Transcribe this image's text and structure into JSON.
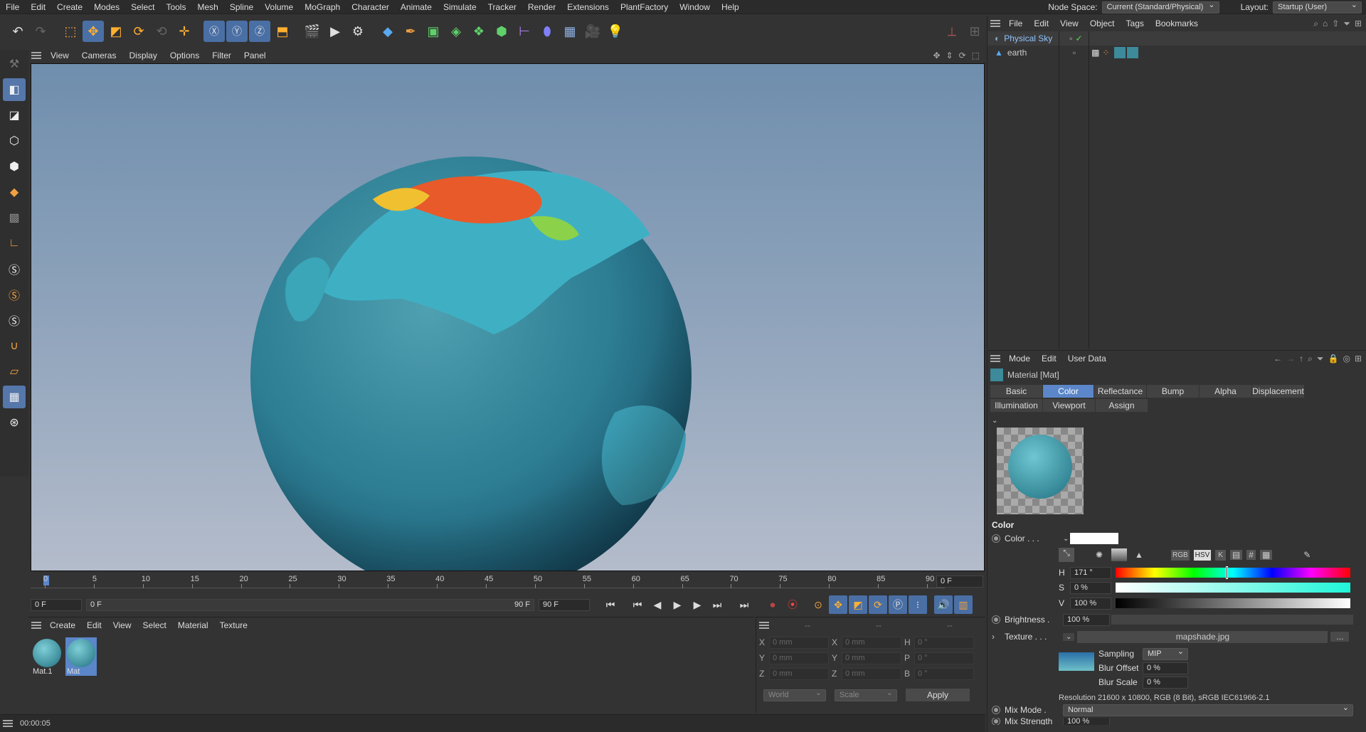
{
  "menubar": {
    "items": [
      "File",
      "Edit",
      "Create",
      "Modes",
      "Select",
      "Tools",
      "Mesh",
      "Spline",
      "Volume",
      "MoGraph",
      "Character",
      "Animate",
      "Simulate",
      "Tracker",
      "Render",
      "Extensions",
      "PlantFactory",
      "Window",
      "Help"
    ],
    "node_space_label": "Node Space:",
    "node_space_value": "Current (Standard/Physical)",
    "layout_label": "Layout:",
    "layout_value": "Startup (User)"
  },
  "viewport": {
    "menu": [
      "View",
      "Cameras",
      "Display",
      "Options",
      "Filter",
      "Panel"
    ]
  },
  "timeline": {
    "ticks": [
      "0",
      "5",
      "10",
      "15",
      "20",
      "25",
      "30",
      "35",
      "40",
      "45",
      "50",
      "55",
      "60",
      "65",
      "70",
      "75",
      "80",
      "85",
      "90"
    ],
    "current_frame": "0 F",
    "start_field": "0 F",
    "range_start": "0 F",
    "range_end": "90 F",
    "end_field": "90 F"
  },
  "material_manager": {
    "menu": [
      "Create",
      "Edit",
      "View",
      "Select",
      "Material",
      "Texture"
    ],
    "materials": [
      {
        "name": "Mat.1",
        "selected": false
      },
      {
        "name": "Mat",
        "selected": true
      }
    ]
  },
  "coordinates": {
    "header": [
      "--",
      "--",
      "--"
    ],
    "rows": [
      {
        "a": "X",
        "av": "0 mm",
        "b": "X",
        "bv": "0 mm",
        "c": "H",
        "cv": "0 °"
      },
      {
        "a": "Y",
        "av": "0 mm",
        "b": "Y",
        "bv": "0 mm",
        "c": "P",
        "cv": "0 °"
      },
      {
        "a": "Z",
        "av": "0 mm",
        "b": "Z",
        "bv": "0 mm",
        "c": "B",
        "cv": "0 °"
      }
    ],
    "space_select": "World",
    "mode_select": "Scale",
    "apply_label": "Apply"
  },
  "status": {
    "time": "00:00:05"
  },
  "object_manager": {
    "menu": [
      "File",
      "Edit",
      "View",
      "Object",
      "Tags",
      "Bookmarks"
    ],
    "objects": [
      {
        "name": "Physical Sky"
      },
      {
        "name": "earth"
      }
    ]
  },
  "attributes": {
    "menu": [
      "Mode",
      "Edit",
      "User Data"
    ],
    "title": "Material [Mat]",
    "tabs_row1": [
      "Basic",
      "Color",
      "Reflectance",
      "Bump",
      "Alpha",
      "Displacement"
    ],
    "tabs_row2": [
      "Illumination",
      "Viewport",
      "Assign"
    ],
    "active_tab": "Color",
    "section_title": "Color",
    "color_label": "Color . . .",
    "color_buttons": [
      "RGB",
      "HSV",
      "K"
    ],
    "h_label": "H",
    "h_value": "171 °",
    "s_label": "S",
    "s_value": "0 %",
    "v_label": "V",
    "v_value": "100 %",
    "brightness_label": "Brightness .",
    "brightness_value": "100 %",
    "texture_label": "Texture . . .",
    "texture_file": "mapshade.jpg",
    "texture_more": "...",
    "sampling_label": "Sampling",
    "sampling_value": "MIP",
    "blur_offset_label": "Blur Offset",
    "blur_offset_value": "0 %",
    "blur_scale_label": "Blur Scale",
    "blur_scale_value": "0 %",
    "resolution_text": "Resolution 21600 x 10800, RGB (8 Bit), sRGB IEC61966-2.1",
    "mix_mode_label": "Mix Mode .",
    "mix_mode_value": "Normal",
    "mix_strength_label": "Mix Strength",
    "mix_strength_value": "100 %"
  },
  "colors": {
    "accent": "#5b86c9",
    "panel": "#333333"
  }
}
